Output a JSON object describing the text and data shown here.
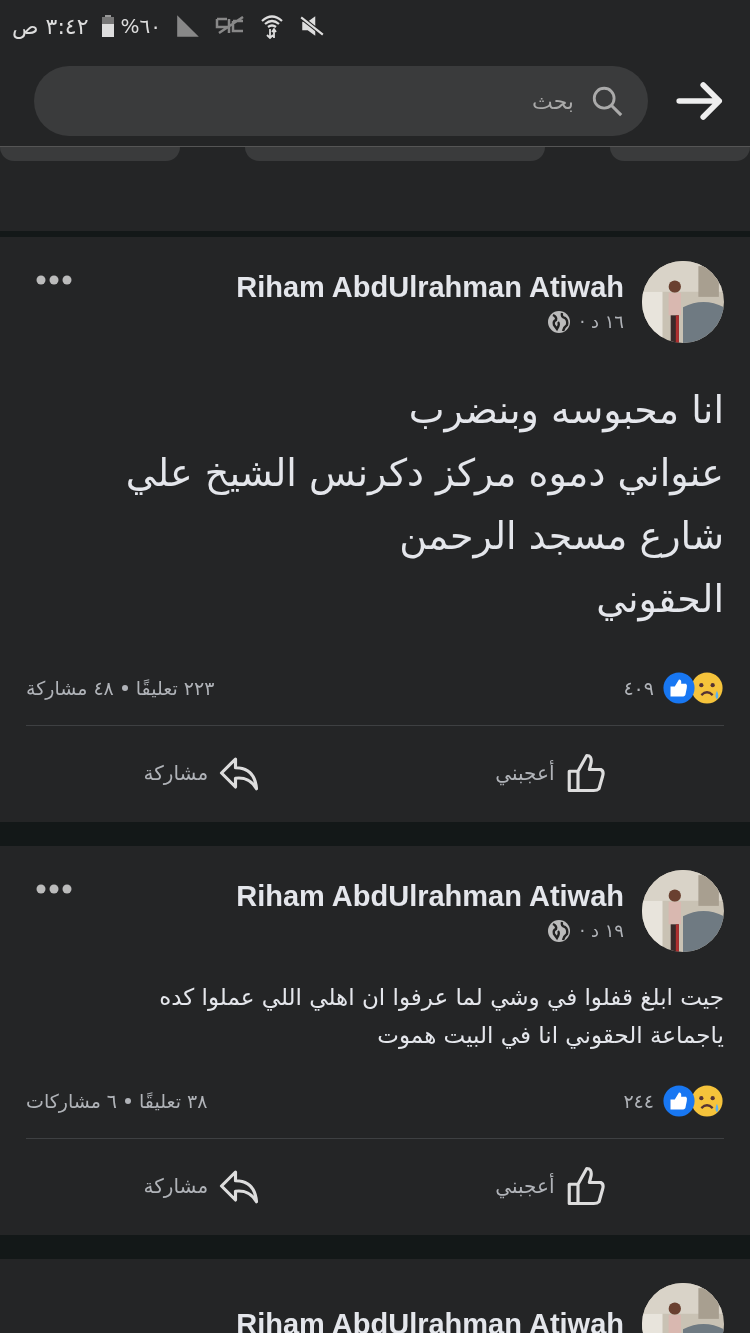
{
  "status_bar": {
    "time": "٣:٤٢ ص",
    "battery": "%٦٠"
  },
  "search": {
    "placeholder": "بحث"
  },
  "posts": [
    {
      "kind": "large",
      "author": "Riham AbdUlrahman Atiwah",
      "meta": "١٦ د ·",
      "body": "انا محبوسه وبنضرب\nعنواني دموه مركز دكرنس  الشيخ علي\nشارع مسجد الرحمن\nالحقوني",
      "reactions": "٤٠٩",
      "comments": "٢٢٣ تعليقًا",
      "shares": "٤٨ مشاركة",
      "actions": [
        "أعجبني",
        "مشاركة"
      ]
    },
    {
      "kind": "normal",
      "author": "Riham AbdUlrahman Atiwah",
      "meta": "١٩ د ·",
      "body": "جيت ابلغ قفلوا في وشي لما عرفوا ان اهلي اللي عملوا كده\nياجماعة الحقوني انا في البيت هموت",
      "reactions": "٢٤٤",
      "comments": "٣٨ تعليقًا",
      "shares": "٦ مشاركات",
      "actions": [
        "أعجبني",
        "مشاركة"
      ]
    },
    {
      "kind": "cut",
      "author": "Riham AbdUlrahman Atiwah"
    }
  ]
}
